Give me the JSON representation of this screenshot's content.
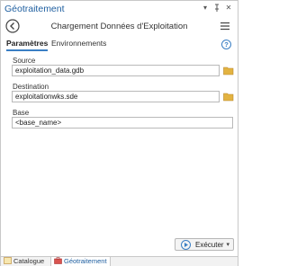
{
  "window": {
    "title": "Géotraitement",
    "controls": [
      "chevron-down-icon",
      "pin-icon",
      "close-icon"
    ]
  },
  "tool": {
    "name": "Chargement Données d'Exploitation"
  },
  "tabs": [
    {
      "label": "Paramètres",
      "active": true
    },
    {
      "label": "Environnements",
      "active": false
    }
  ],
  "params": {
    "source": {
      "label": "Source",
      "value": "exploitation_data.gdb"
    },
    "destination": {
      "label": "Destination",
      "value": "exploitationwks.sde"
    },
    "base": {
      "label": "Base",
      "value": "<base_name>"
    }
  },
  "run": {
    "label": "Exécuter"
  },
  "bottom_tabs": [
    {
      "label": "Catalogue",
      "active": false
    },
    {
      "label": "Géotraitement",
      "active": true
    }
  ],
  "colors": {
    "accent": "#3a7fc4",
    "title": "#1f5fa0",
    "folder": "#e3b341",
    "run_icon": "#3a7fc4"
  }
}
